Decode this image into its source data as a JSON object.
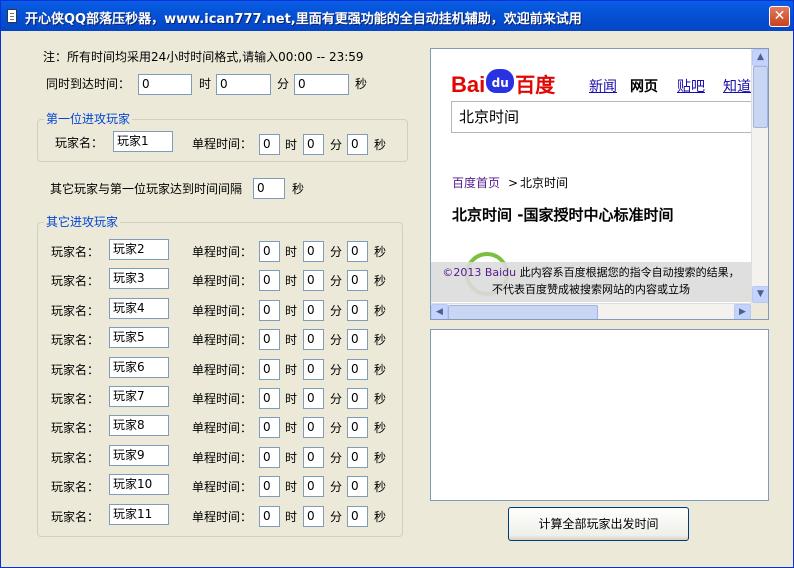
{
  "window": {
    "title": "开心侠QQ部落压秒器，www.ican777.net,里面有更强功能的全自动挂机辅助，欢迎前来试用",
    "close_glyph": "✕"
  },
  "note": "注：所有时间均采用24小时时间格式,请输入00:00 -- 23:59",
  "arrival": {
    "label": "同时到达时间：",
    "hour": "0",
    "minute": "0",
    "second": "0",
    "hour_unit": "时",
    "minute_unit": "分",
    "second_unit": "秒"
  },
  "first_group": {
    "title": "第一位进攻玩家",
    "name_label": "玩家名：",
    "name": "玩家1",
    "trip_label": "单程时间：",
    "hour": "0",
    "minute": "0",
    "second": "0"
  },
  "interval": {
    "label": "其它玩家与第一位玩家达到时间间隔",
    "value": "0",
    "unit": "秒"
  },
  "others_group": {
    "title": "其它进攻玩家",
    "name_label": "玩家名：",
    "trip_label": "单程时间：",
    "players": [
      {
        "name": "玩家2",
        "hour": "0",
        "minute": "0",
        "second": "0"
      },
      {
        "name": "玩家3",
        "hour": "0",
        "minute": "0",
        "second": "0"
      },
      {
        "name": "玩家4",
        "hour": "0",
        "minute": "0",
        "second": "0"
      },
      {
        "name": "玩家5",
        "hour": "0",
        "minute": "0",
        "second": "0"
      },
      {
        "name": "玩家6",
        "hour": "0",
        "minute": "0",
        "second": "0"
      },
      {
        "name": "玩家7",
        "hour": "0",
        "minute": "0",
        "second": "0"
      },
      {
        "name": "玩家8",
        "hour": "0",
        "minute": "0",
        "second": "0"
      },
      {
        "name": "玩家9",
        "hour": "0",
        "minute": "0",
        "second": "0"
      },
      {
        "name": "玩家10",
        "hour": "0",
        "minute": "0",
        "second": "0"
      },
      {
        "name": "玩家11",
        "hour": "0",
        "minute": "0",
        "second": "0"
      }
    ]
  },
  "browser": {
    "logo_bai": "Bai",
    "logo_paw": "du",
    "logo_du": "百度",
    "nav": [
      "新闻",
      "网页",
      "贴吧",
      "知道"
    ],
    "search_value": "北京时间",
    "breadcrumb_home": "百度首页",
    "breadcrumb_sep": ">",
    "breadcrumb_current": "北京时间",
    "heading": "北京时间  -国家授时中心标准时间",
    "copyright_link": "©2013 Baidu",
    "copyright_line1": "此内容系百度根据您的指令自动搜索的结果，",
    "copyright_line2": "不代表百度赞成被搜索网站的内容或立场"
  },
  "calc_button": "计算全部玩家出发时间",
  "colors": {
    "group_title": "#0046d5",
    "titlebar": "#0552d6",
    "baidu_red": "#e10601",
    "baidu_blue": "#2932e1",
    "link_blue": "#1a0dab",
    "visited_purple": "#551a8b"
  }
}
